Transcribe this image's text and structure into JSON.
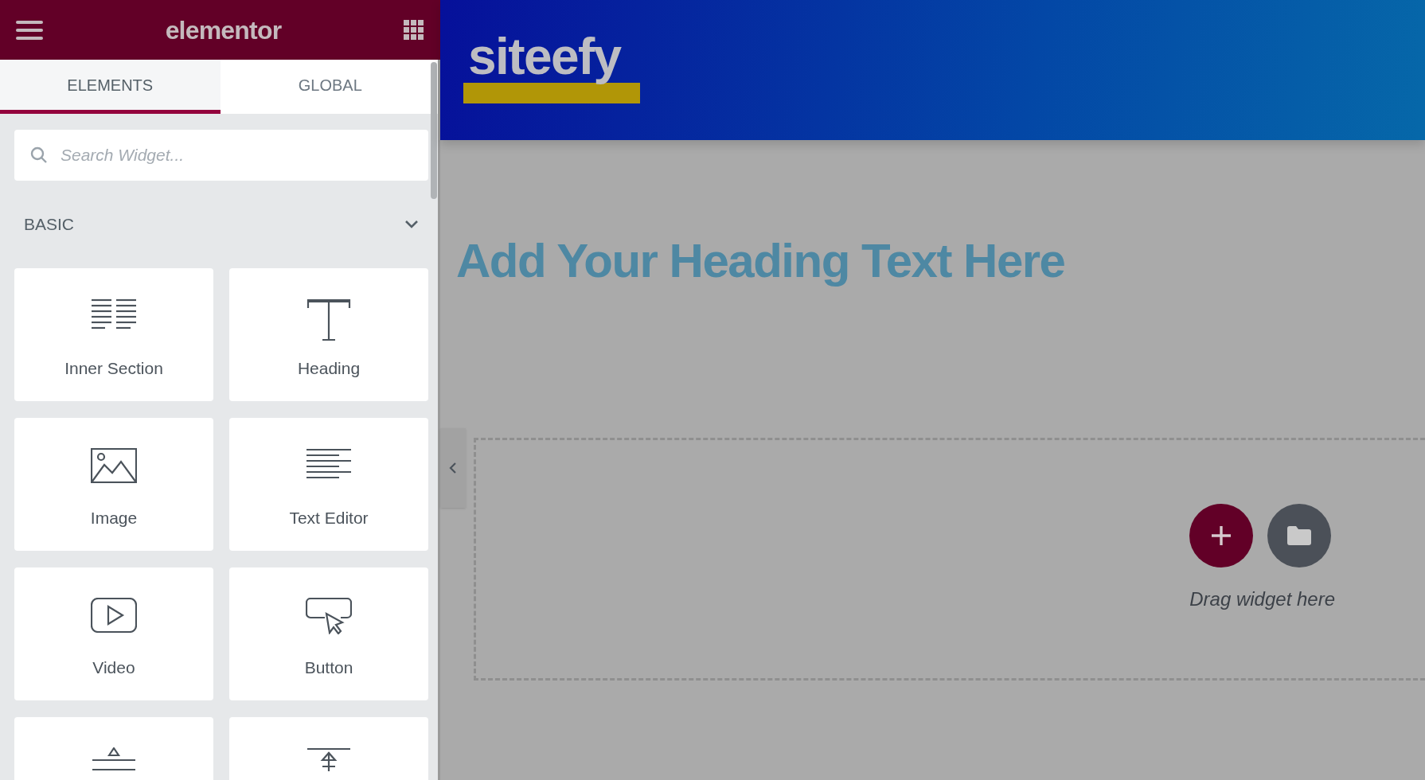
{
  "panel_header": {
    "logo": "elementor"
  },
  "tabs": [
    {
      "label": "ELEMENTS",
      "selected": true
    },
    {
      "label": "GLOBAL",
      "selected": false
    }
  ],
  "search": {
    "placeholder": "Search Widget..."
  },
  "category": {
    "label": "BASIC",
    "expanded": true
  },
  "widgets": [
    {
      "kind": "inner-section",
      "label": "Inner Section"
    },
    {
      "kind": "heading",
      "label": "Heading"
    },
    {
      "kind": "image",
      "label": "Image"
    },
    {
      "kind": "text-editor",
      "label": "Text Editor"
    },
    {
      "kind": "video",
      "label": "Video"
    },
    {
      "kind": "button",
      "label": "Button"
    },
    {
      "kind": "divider"
    },
    {
      "kind": "spacer"
    }
  ],
  "site_header": {
    "logo": "siteefy"
  },
  "page": {
    "heading": "Add Your Heading Text Here",
    "drop_zone": {
      "hint": "Drag widget here"
    }
  }
}
